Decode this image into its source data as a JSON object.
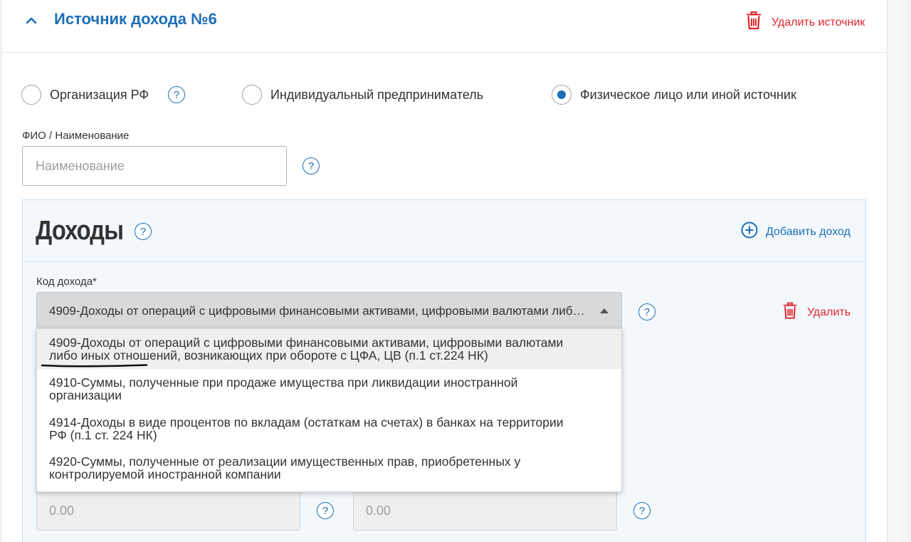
{
  "section": {
    "title": "Источник дохода №6",
    "delete_label": "Удалить источник"
  },
  "source_type": {
    "options": [
      {
        "label": "Организация РФ",
        "selected": false,
        "has_help": true
      },
      {
        "label": "Индивидуальный предприниматель",
        "selected": false,
        "has_help": false
      },
      {
        "label": "Физическое лицо или иной источник",
        "selected": true,
        "has_help": false
      }
    ]
  },
  "name_field": {
    "label": "ФИО / Наименование",
    "placeholder": "Наименование",
    "value": ""
  },
  "incomes": {
    "title": "Доходы",
    "add_label": "Добавить доход",
    "code_label": "Код дохода*",
    "selected_value": "4909-Доходы от операций с цифровыми финансовыми активами, цифровыми валютами либо иных отношений, возникающих при обороте с ЦФА, ЦВ (п.1 ст.224 НК)",
    "delete_label": "Удалить",
    "options": [
      {
        "line1": "4909-Доходы от операций с цифровыми финансовыми активами, цифровыми валютами",
        "line2": "либо иных отношений, возникающих при обороте с ЦФА, ЦВ (п.1 ст.224 НК)"
      },
      {
        "line1": "4910-Суммы, полученные при продаже имущества при ликвидации иностранной",
        "line2": "организации"
      },
      {
        "line1": "4914-Доходы в виде процентов по вкладам (остаткам на счетах) в банках на территории",
        "line2": "РФ (п.1 ст. 224 НК)"
      },
      {
        "line1": "4920-Суммы, полученные от реализации имущественных прав, приобретенных у",
        "line2": "контролируемой иностранной компании"
      }
    ],
    "amount_1": "0.00",
    "amount_2": "0.00"
  },
  "colors": {
    "accent": "#1d6fb8",
    "danger": "#e0262f",
    "panel_bg": "#f3f8fd"
  },
  "icons": [
    "chevron-up-icon",
    "trash-icon",
    "help-icon",
    "plus-circle-icon",
    "caret-up-icon"
  ]
}
